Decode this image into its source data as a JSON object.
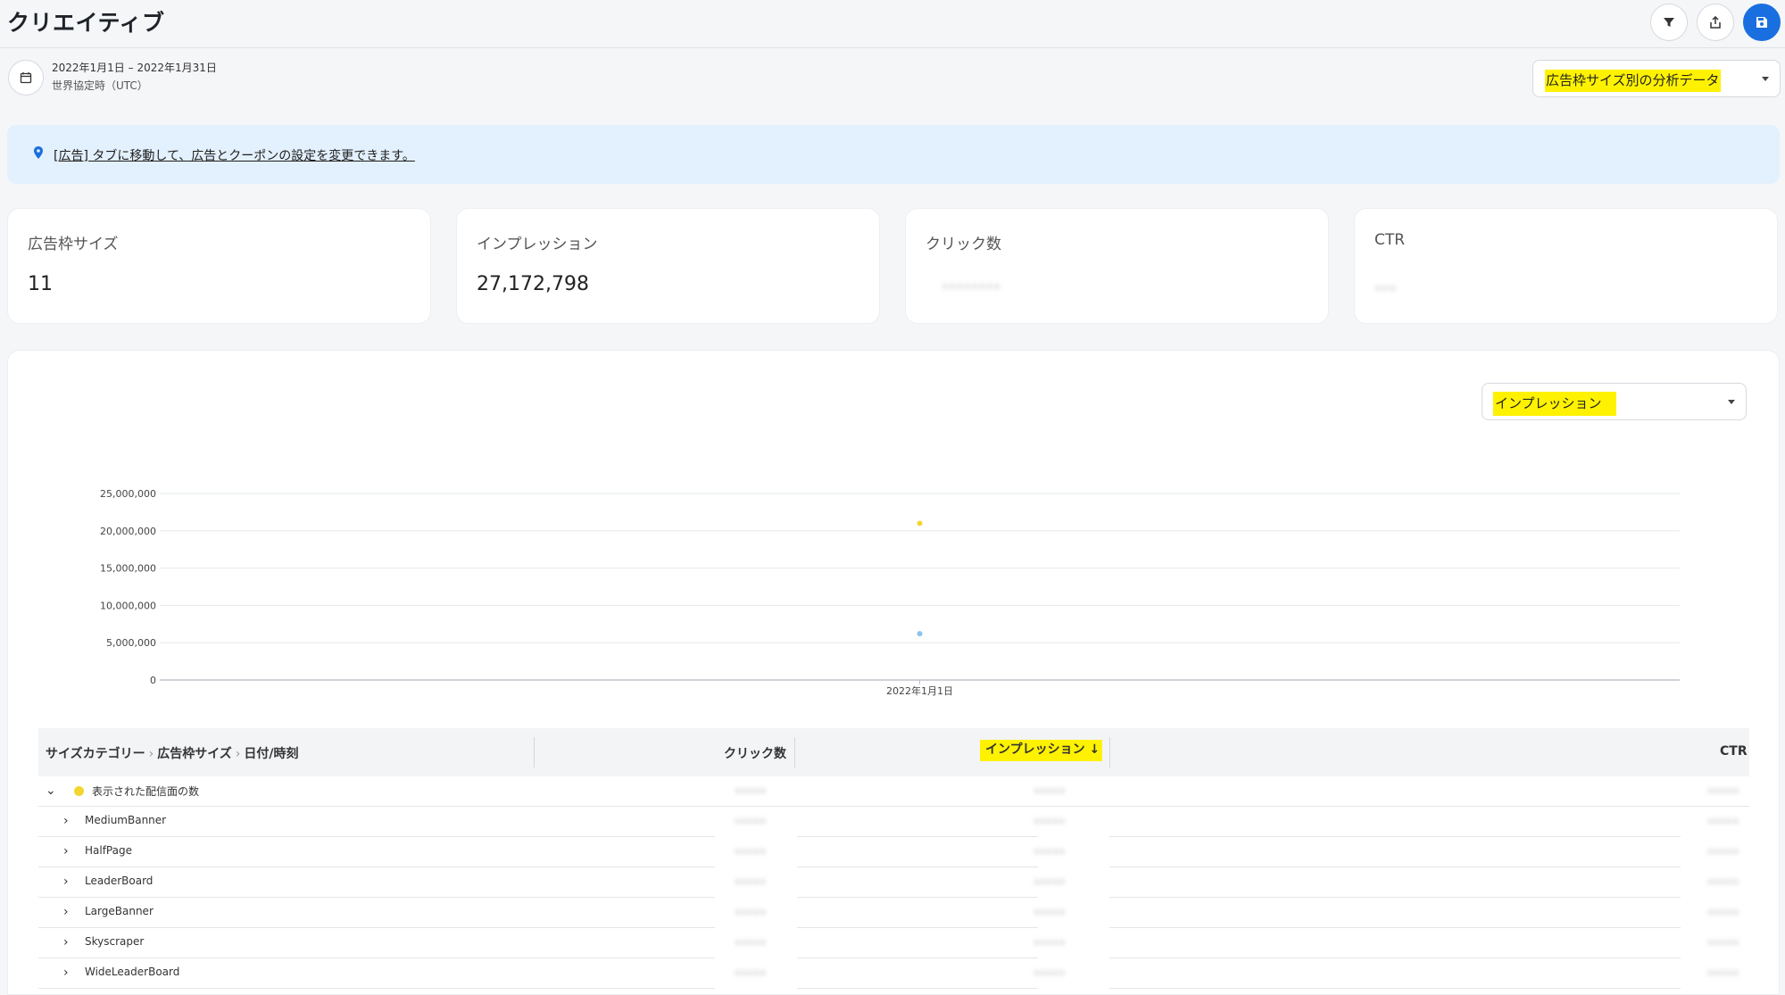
{
  "header": {
    "title": "クリエイティブ",
    "icons": [
      "filter-icon",
      "share-icon",
      "save-icon"
    ]
  },
  "date_filter": {
    "range": "2022年1月1日 – 2022年1月31日",
    "timezone": "世界協定時（UTC）"
  },
  "report_select": {
    "selected": "広告枠サイズ別の分析データ"
  },
  "info_banner": {
    "link_text": "[広告] タブに移動して、広告とクーポンの設定を変更できます。"
  },
  "stats": [
    {
      "label": "広告枠サイズ",
      "value": "11"
    },
    {
      "label": "インプレッション",
      "value": "27,172,798"
    },
    {
      "label": "クリック数",
      "value": "••••••••"
    },
    {
      "label": "CTR",
      "value": "•••"
    }
  ],
  "metric_select": {
    "selected": "インプレッション"
  },
  "chart_data": {
    "type": "scatter",
    "x_categories": [
      "2022年1月1日"
    ],
    "yticks": [
      "25,000,000",
      "20,000,000",
      "15,000,000",
      "10,000,000",
      "5,000,000",
      "0"
    ],
    "ylim": [
      0,
      25000000
    ],
    "series": [
      {
        "color": "#f3d530",
        "values": [
          21000000
        ]
      },
      {
        "color": "#8cc4ee",
        "values": [
          6200000
        ]
      }
    ]
  },
  "table": {
    "breadcrumb": [
      "サイズカテゴリー",
      "広告枠サイズ",
      "日付/時刻"
    ],
    "columns": {
      "clicks": "クリック数",
      "impressions": "インプレッション ↓",
      "ctr": "CTR"
    },
    "group": {
      "label": "表示された配信面の数",
      "color": "#f3d530"
    },
    "rows": [
      {
        "label": "MediumBanner"
      },
      {
        "label": "HalfPage"
      },
      {
        "label": "LeaderBoard"
      },
      {
        "label": "LargeBanner"
      },
      {
        "label": "Skyscraper"
      },
      {
        "label": "WideLeaderBoard"
      }
    ],
    "blurred_placeholder": "•••••"
  },
  "colors": {
    "accent": "#1a6fe0",
    "highlight": "#fff200",
    "banner": "#e3f0fd"
  }
}
